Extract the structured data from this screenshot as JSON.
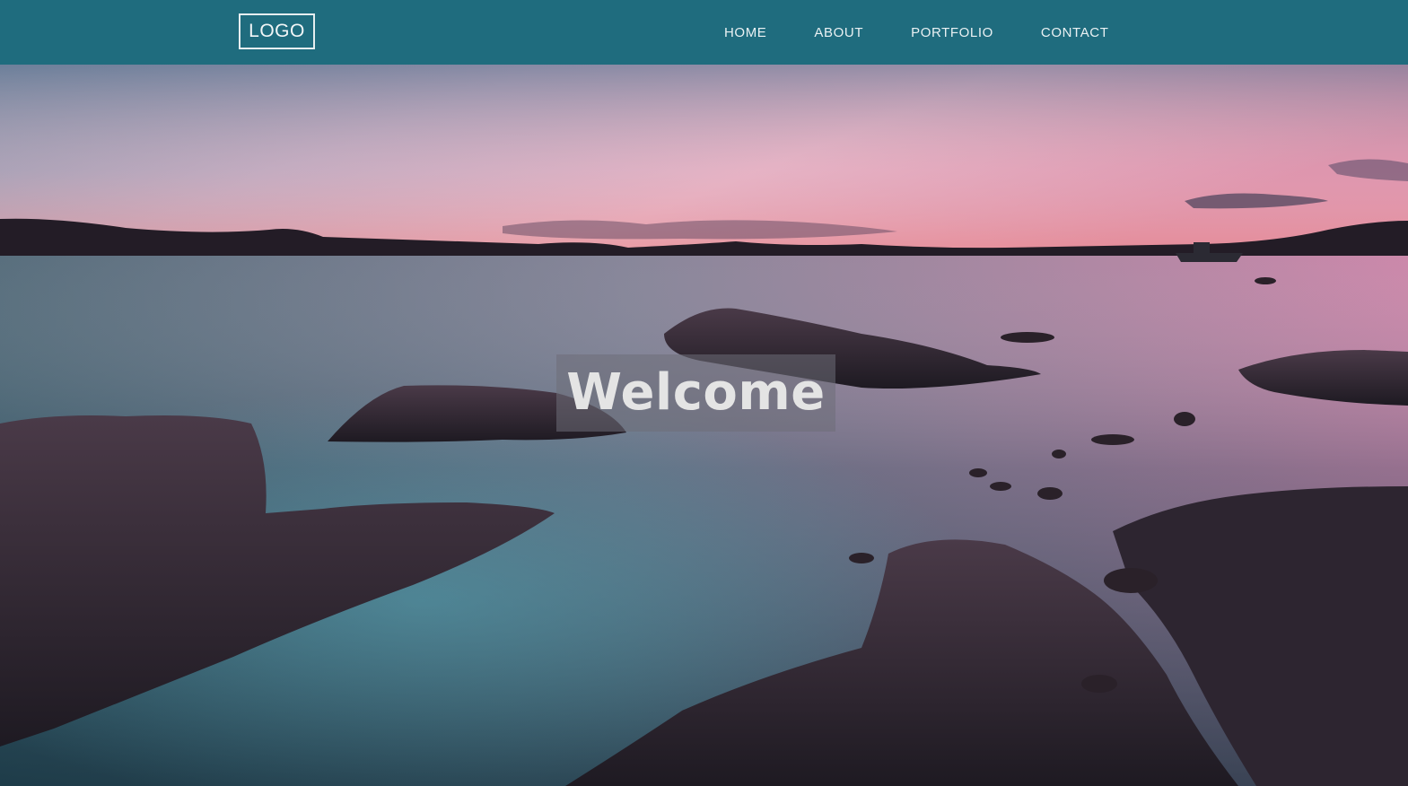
{
  "header": {
    "logo_text": "LOGO",
    "background_color": "#1f6c7e"
  },
  "nav": {
    "items": [
      {
        "label": "HOME"
      },
      {
        "label": "ABOUT"
      },
      {
        "label": "PORTFOLIO"
      },
      {
        "label": "CONTACT"
      }
    ]
  },
  "hero": {
    "heading": "Welcome",
    "image_subject": "sunset seascape with rocky shoreline"
  }
}
